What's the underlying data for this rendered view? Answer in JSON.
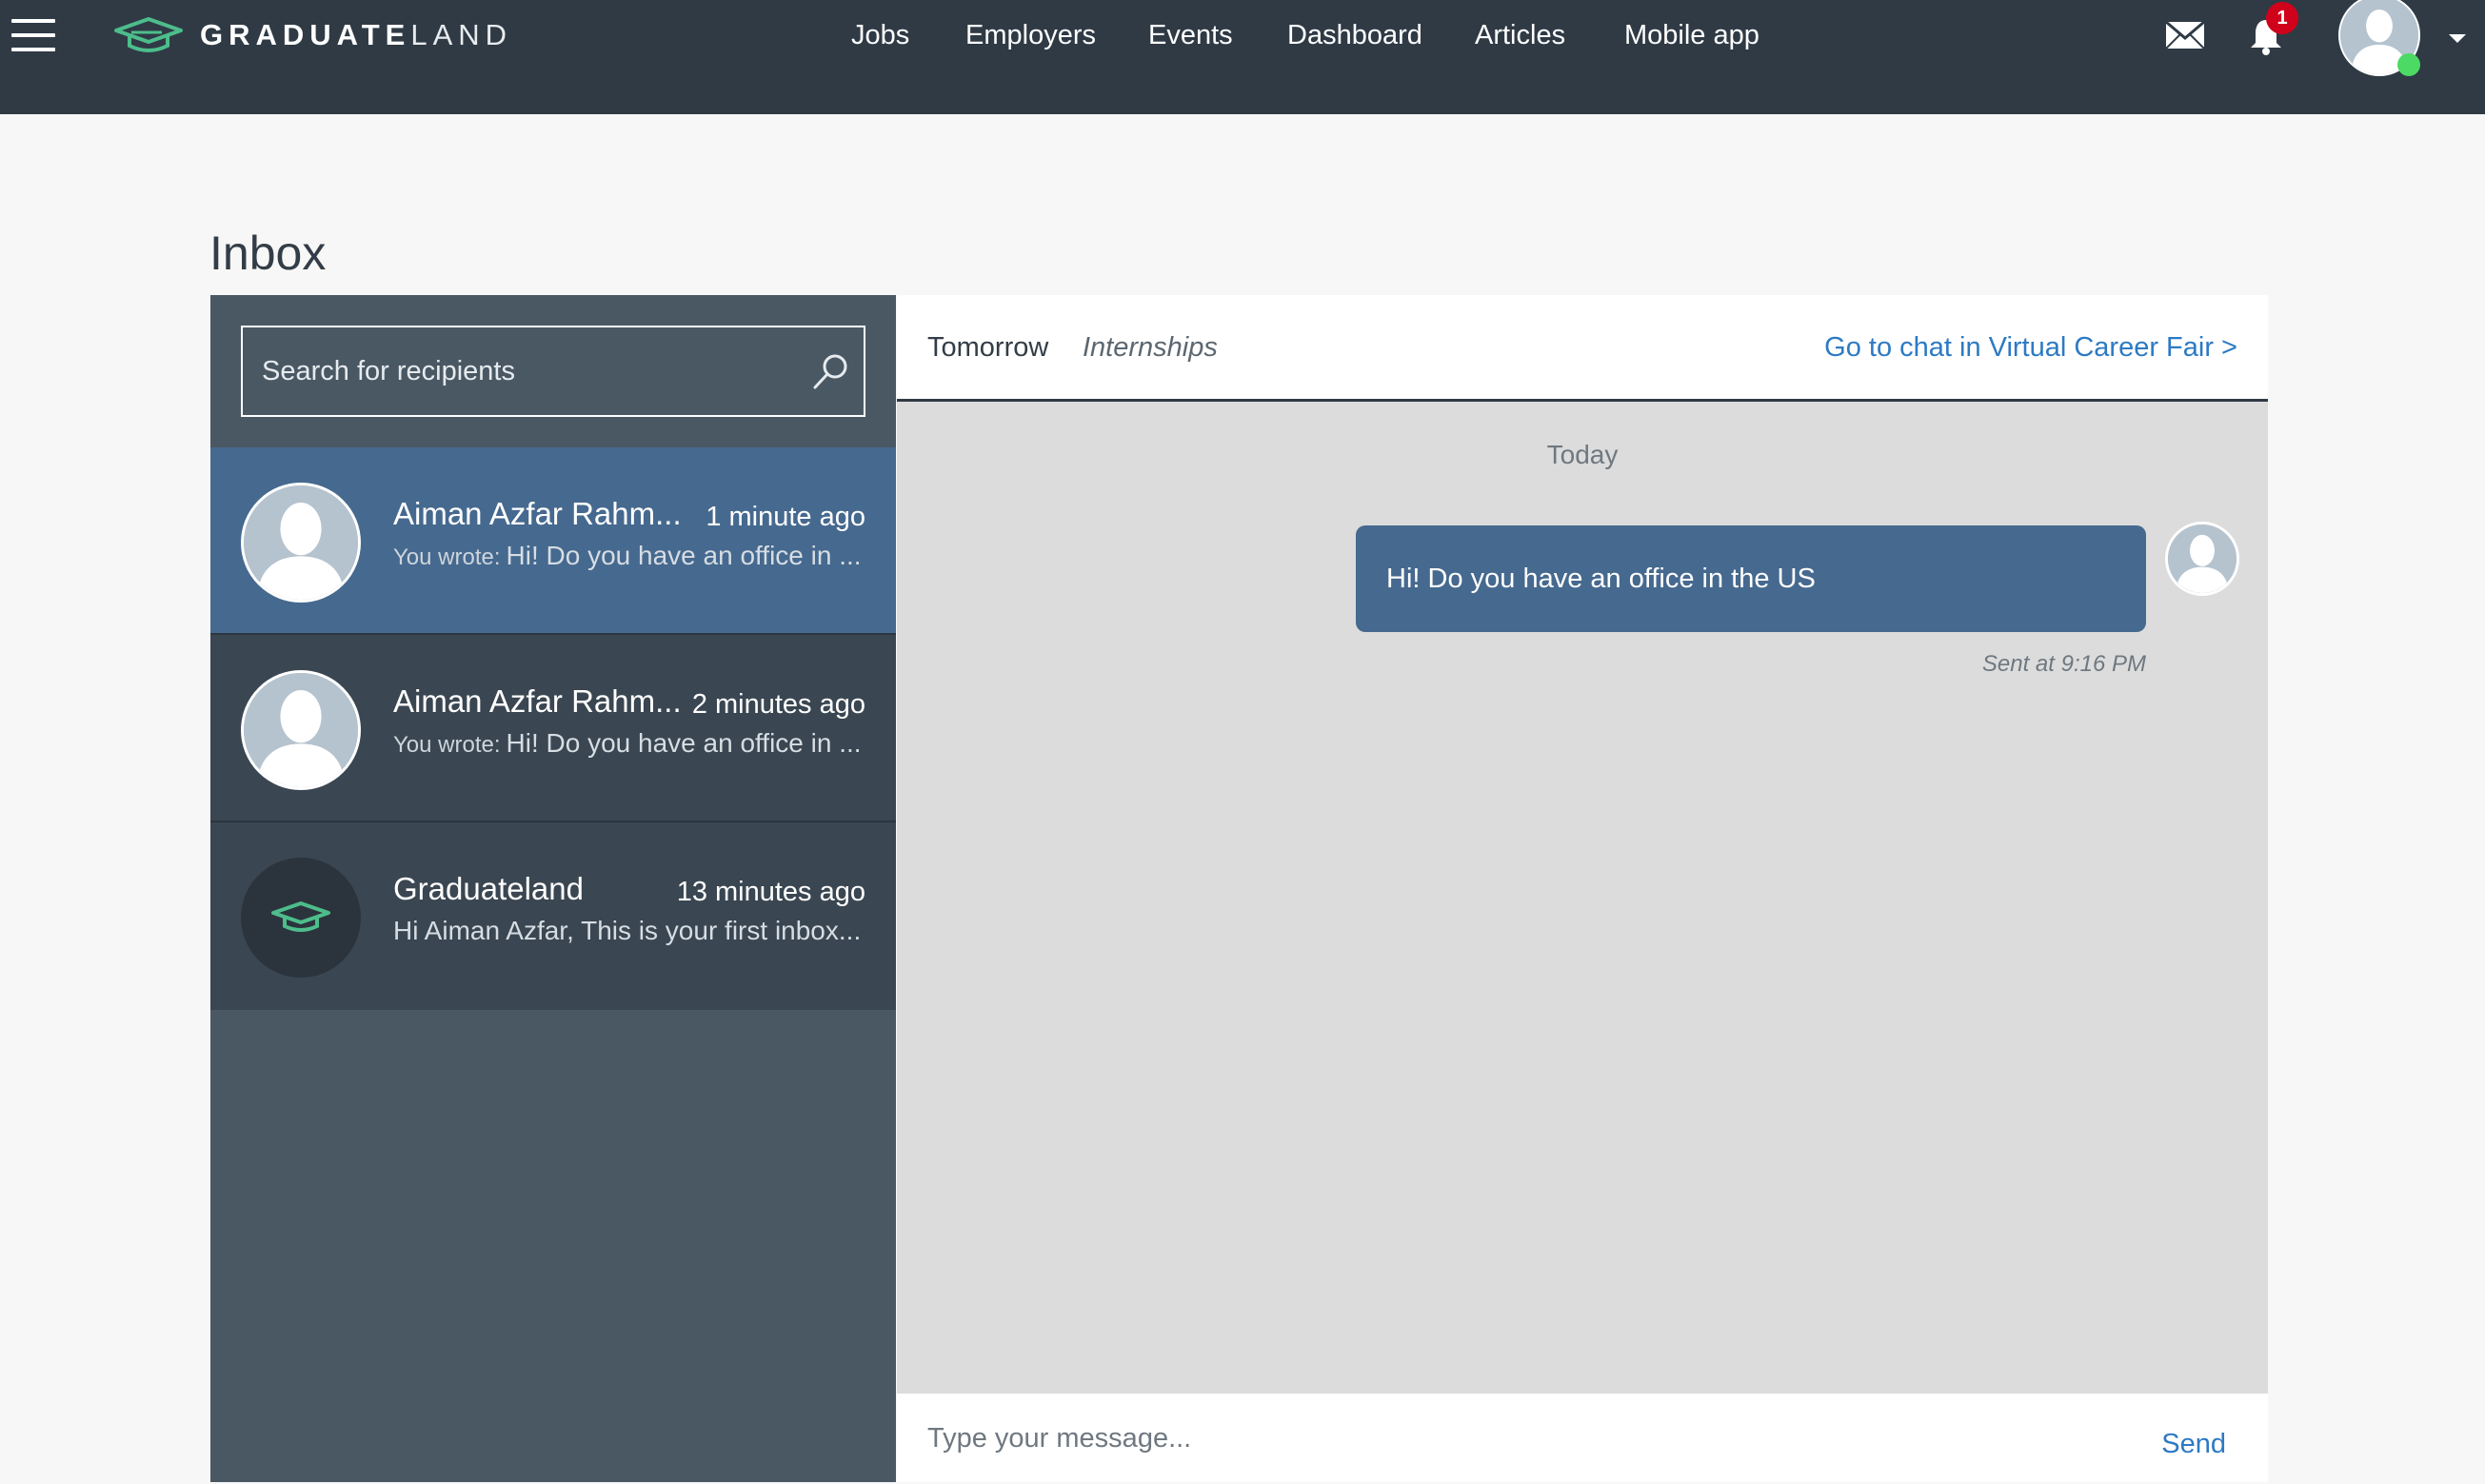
{
  "brand": {
    "name_bold": "GRADUATE",
    "name_light": "LAND"
  },
  "nav": {
    "items": [
      "Jobs",
      "Employers",
      "Events",
      "Dashboard",
      "Articles",
      "Mobile app"
    ],
    "notification_count": "1"
  },
  "page": {
    "title": "Inbox"
  },
  "search": {
    "placeholder": "Search for recipients"
  },
  "conversations": [
    {
      "name": "Aiman Azfar Rahm...",
      "time": "1 minute ago",
      "prefix": "You wrote:",
      "preview": "Hi! Do you have an office in ...",
      "state": "active"
    },
    {
      "name": "Aiman Azfar Rahm...",
      "time": "2 minutes ago",
      "prefix": "You wrote:",
      "preview": "Hi! Do you have an office in ...",
      "state": "default"
    },
    {
      "name": "Graduateland",
      "time": "13 minutes ago",
      "prefix": "",
      "preview": "Hi Aiman Azfar, This is your first inbox...",
      "state": "default"
    }
  ],
  "chat": {
    "header_primary": "Tomorrow",
    "header_secondary": "Internships",
    "goto_link": "Go to chat in Virtual Career Fair >",
    "day_label": "Today",
    "message": "Hi! Do you have an office in the US",
    "sent_time": "Sent at 9:16 PM"
  },
  "compose": {
    "placeholder": "Type your message...",
    "send_label": "Send"
  },
  "colors": {
    "topbar": "#2f3a45",
    "panel": "#4a5864",
    "active_conversation": "#46698f",
    "link": "#2d7ac3",
    "brand_green": "#4dbd8b",
    "notification": "#d0021b",
    "online": "#4cd964"
  }
}
